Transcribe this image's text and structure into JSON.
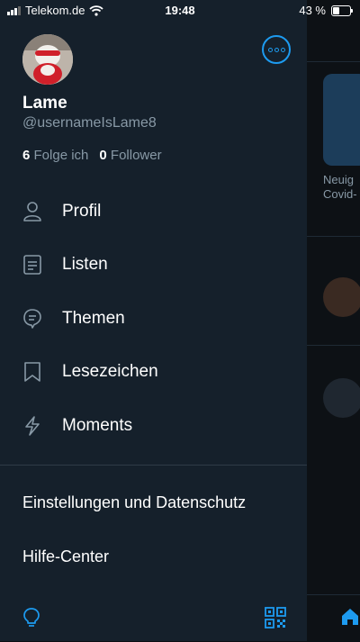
{
  "status_bar": {
    "carrier": "Telekom.de",
    "time": "19:48",
    "battery": "43 %",
    "battery_level": 0.43
  },
  "profile": {
    "name": "Lame",
    "handle": "@usernameIsLame8",
    "following_count": "6",
    "following_label": "Folge ich",
    "followers_count": "0",
    "followers_label": "Follower"
  },
  "menu": {
    "items": [
      {
        "label": "Profil",
        "icon": "person-icon"
      },
      {
        "label": "Listen",
        "icon": "list-icon"
      },
      {
        "label": "Themen",
        "icon": "topics-icon"
      },
      {
        "label": "Lesezeichen",
        "icon": "bookmark-icon"
      },
      {
        "label": "Moments",
        "icon": "lightning-icon"
      }
    ]
  },
  "settings": {
    "privacy_label": "Einstellungen und Datenschutz",
    "help_label": "Hilfe-Center"
  },
  "background": {
    "card_text_1": "Neuig",
    "card_text_2": "Covid-"
  },
  "colors": {
    "accent": "#1d9bf0",
    "drawer_bg": "#15202b",
    "secondary_text": "#8899a6"
  }
}
